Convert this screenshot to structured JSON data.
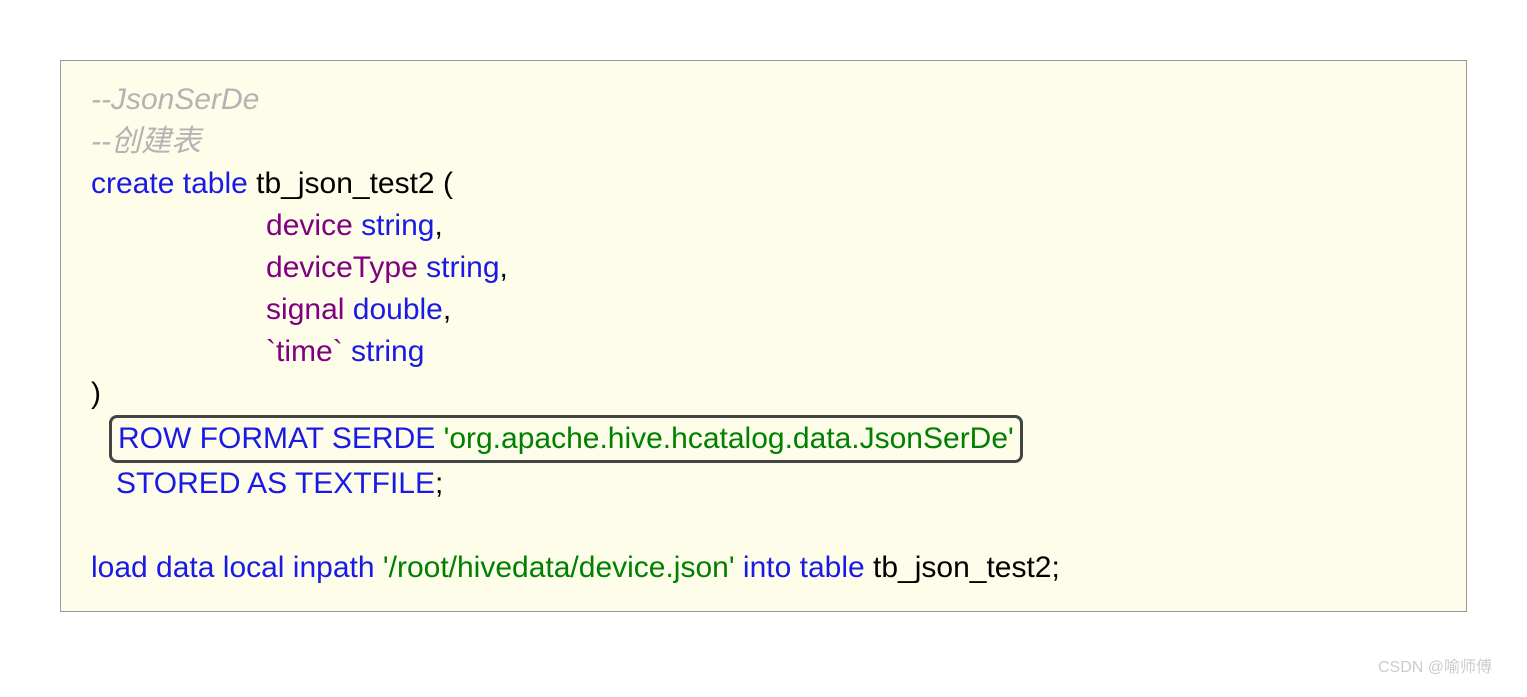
{
  "code": {
    "line1_comment": "--JsonSerDe",
    "line2_comment": "--创建表",
    "line3_kw1": "create",
    "line3_kw2": "table",
    "line3_ident": "tb_json_test2 (",
    "line4_field": "device",
    "line4_type": "string",
    "line5_field": "deviceType",
    "line5_type": "string",
    "line6_field": "signal",
    "line6_type": "double",
    "line7_field": "`time`",
    "line7_type": "string",
    "line8_paren": ")",
    "line9_kw": "ROW FORMAT SERDE",
    "line9_str": "'org.apache.hive.hcatalog.data.JsonSerDe'",
    "line10_kw": "STORED AS TEXTFILE",
    "line10_semi": ";",
    "line12_kw1": "load data local inpath",
    "line12_str": "'/root/hivedata/device.json'",
    "line12_kw2": "into table",
    "line12_ident": "tb_json_test2",
    "line12_semi": ";"
  },
  "watermark": "CSDN @喻师傅"
}
